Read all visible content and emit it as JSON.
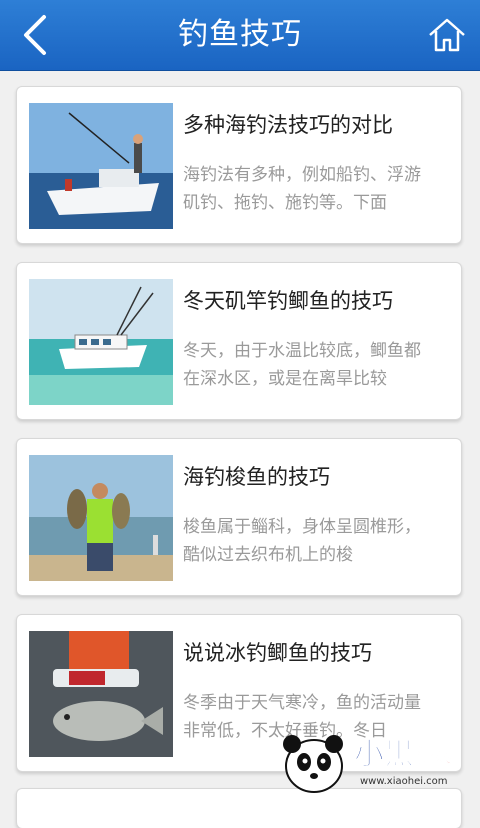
{
  "header": {
    "title": "钓鱼技巧"
  },
  "articles": [
    {
      "title": "多种海钓法技巧的对比",
      "summary": "海钓法有多种，例如船钓、浮游矶钓、拖钓、施钓等。下面"
    },
    {
      "title": "冬天矶竿钓鲫鱼的技巧",
      "summary": "冬天，由于水温比较底，鲫鱼都在深水区，或是在离旱比较"
    },
    {
      "title": "海钓梭鱼的技巧",
      "summary": "梭鱼属于鲻科，身体呈圆椎形，酷似过去织布机上的梭"
    },
    {
      "title": "说说冰钓鲫鱼的技巧",
      "summary": "冬季由于天气寒冷，鱼的活动量非常低，不太好垂钓。冬日"
    }
  ],
  "watermark": {
    "logo_text": "小黑游戏",
    "url": "www.xiaohei.com"
  },
  "colors": {
    "header": "#1f6fce",
    "card_bg": "#ffffff",
    "summary_text": "#9a9a9a"
  }
}
